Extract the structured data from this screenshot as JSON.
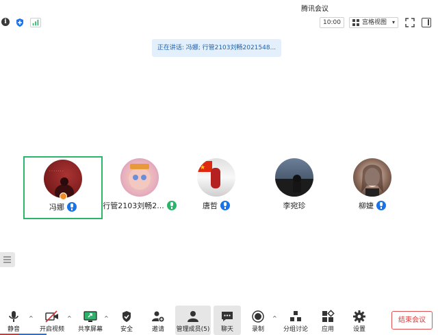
{
  "window": {
    "title": "腾讯会议"
  },
  "topbar": {
    "time": "10:00",
    "view_label": "宫格视图",
    "icons": [
      "info-icon",
      "shield-icon",
      "signal-icon",
      "fullscreen-icon",
      "sidebar-toggle-icon"
    ]
  },
  "speaker_banner": "正在讲话: 冯娜; 行管2103刘畅2021548...",
  "participants": [
    {
      "name": "冯娜",
      "active": true
    },
    {
      "name": "行管2103刘畅2...",
      "active": false
    },
    {
      "name": "唐哲",
      "active": false
    },
    {
      "name": "李宛珍",
      "active": false
    },
    {
      "name": "柳婕",
      "active": false
    }
  ],
  "toolbar": {
    "mute": "静音",
    "video": "开启视频",
    "share": "共享屏幕",
    "security": "安全",
    "invite": "邀请",
    "members": "管理成员(5)",
    "chat": "聊天",
    "record": "录制",
    "breakout": "分组讨论",
    "apps": "应用",
    "settings": "设置",
    "end": "结束会议"
  },
  "colors": {
    "active_border": "#2bb56b",
    "accent": "#1a73e8",
    "end": "#d93b3b"
  }
}
